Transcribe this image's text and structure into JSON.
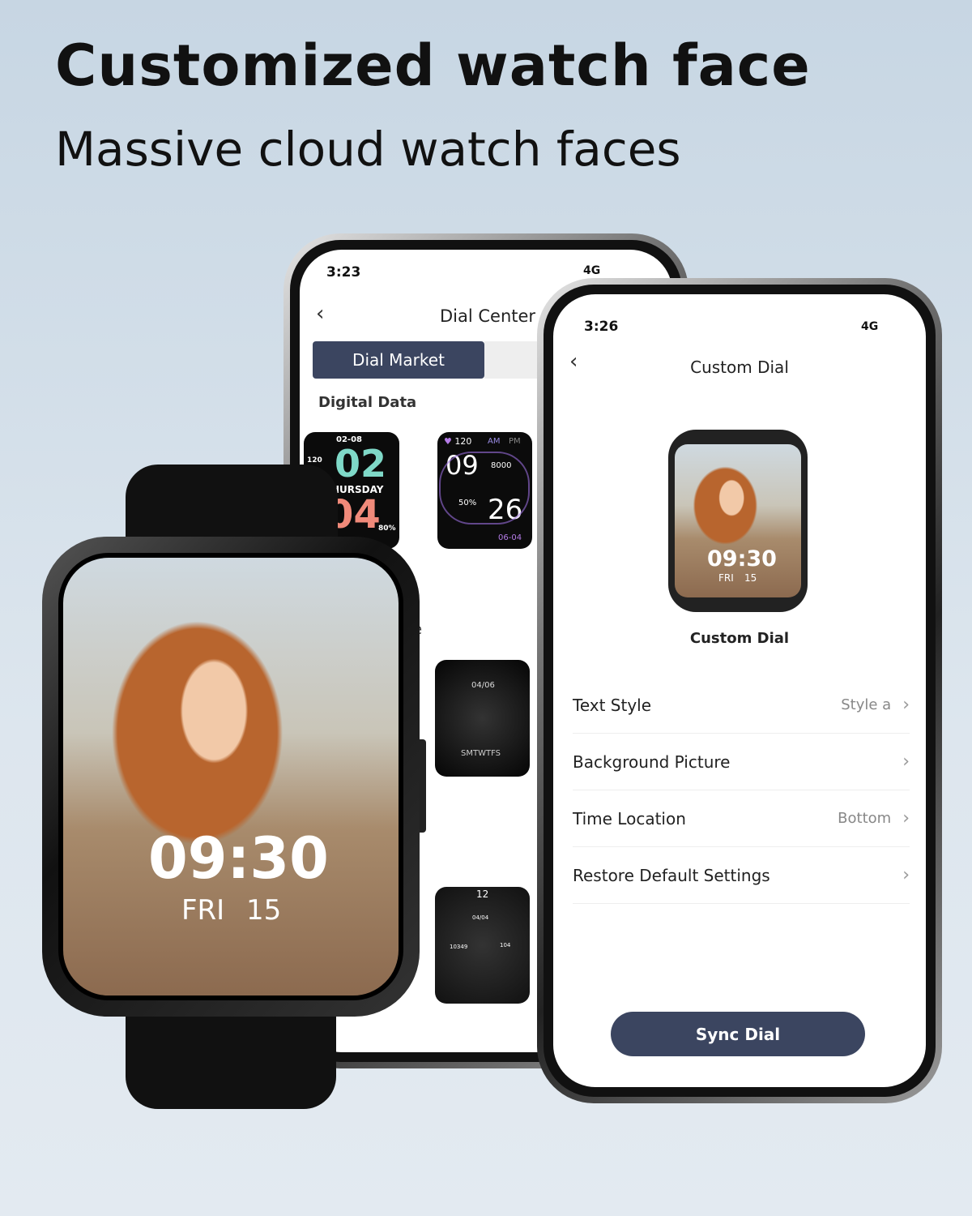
{
  "headline": "Customized watch face",
  "subheadline": "Massive cloud watch faces",
  "back_phone": {
    "time": "3:23",
    "network": "4G",
    "title": "Dial Center",
    "tab_active": "Dial Market",
    "section": "Digital Data",
    "partial_section": "e",
    "faces": [
      {
        "date": "02-08",
        "hour": "02",
        "day": "HURSDAY",
        "min": "04",
        "hr": "120",
        "battery": "80%"
      },
      {
        "hr": "120",
        "am": "AM",
        "pm": "PM",
        "hour": "09",
        "steps": "8000",
        "battery": "50%",
        "min": "26",
        "date": "06-04"
      },
      {
        "date": "04/06",
        "week": "SMTWTFS"
      },
      {
        "twelve": "12",
        "date": "04/04",
        "steps": "10349",
        "hr": "104"
      }
    ]
  },
  "front_phone": {
    "time": "3:26",
    "network": "4G",
    "title": "Custom Dial",
    "preview_time": "09:30",
    "preview_day": "FRI",
    "preview_date": "15",
    "preview_label": "Custom Dial",
    "settings": [
      {
        "label": "Text Style",
        "value": "Style a"
      },
      {
        "label": "Background Picture",
        "value": ""
      },
      {
        "label": "Time Location",
        "value": "Bottom"
      },
      {
        "label": "Restore Default Settings",
        "value": ""
      }
    ],
    "sync_button": "Sync Dial",
    "accent": "#3b4560"
  },
  "watch": {
    "time": "09:30",
    "day": "FRI",
    "date": "15"
  }
}
